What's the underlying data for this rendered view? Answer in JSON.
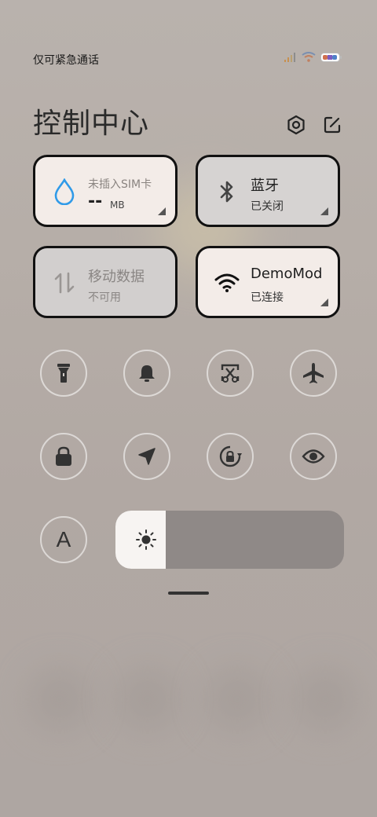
{
  "status_bar": {
    "carrier_text": "仅可紧急通话",
    "icons": [
      "signal-icon",
      "wifi-icon",
      "battery-icon"
    ]
  },
  "header": {
    "title": "控制中心",
    "icons": [
      "settings-icon",
      "edit-icon"
    ]
  },
  "tiles": {
    "data_usage": {
      "title": "未插入SIM卡",
      "value": "--",
      "unit": "MB",
      "icon": "water-drop-icon"
    },
    "bluetooth": {
      "title": "蓝牙",
      "status": "已关闭",
      "icon": "bluetooth-icon"
    },
    "mobile_data": {
      "title": "移动数据",
      "status": "不可用",
      "icon": "data-arrows-icon"
    },
    "wifi": {
      "title": "DemoMod",
      "status": "已连接",
      "icon": "wifi-icon"
    }
  },
  "toggles_row1": [
    "flashlight-icon",
    "bell-icon",
    "screenshot-icon",
    "airplane-icon"
  ],
  "toggles_row2": [
    "lock-icon",
    "location-icon",
    "rotation-lock-icon",
    "eye-icon"
  ],
  "brightness": {
    "auto_label": "A",
    "level": 0.22,
    "icon": "sun-icon"
  },
  "colors": {
    "tile_active": "#f3ece8",
    "tile_inactive": "#d6d3d2",
    "accent_blue": "#2f9ae8"
  }
}
